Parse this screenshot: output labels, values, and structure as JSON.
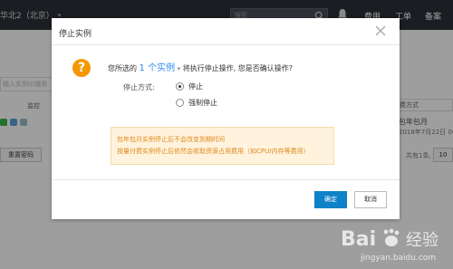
{
  "topbar": {
    "region": "华北2（北京）",
    "search_placeholder": "搜索",
    "links": [
      "费用",
      "工单",
      "备案"
    ]
  },
  "background": {
    "search_placeholder": "输入实例ID搜索",
    "column_monitor": "监控",
    "reset_button": "重置密码",
    "pay_mode_header": "付费方式",
    "pay_mode_value": "包年包月",
    "expire_text": "2018年7月22日 00:00",
    "total_text": "共有1条, 每页",
    "page_button": "10"
  },
  "dialog": {
    "title": "停止实例",
    "question_prefix": "您所选的",
    "question_count": "1 个实例",
    "question_suffix": "将执行停止操作, 您是否确认操作?",
    "stop_mode_label": "停止方式:",
    "options": [
      {
        "label": "停止",
        "checked": true
      },
      {
        "label": "强制停止",
        "checked": false
      }
    ],
    "notice_lines": [
      "包年包月实例停止后不会改变到期时间",
      "按量付费实例停止后依然会收取资源占用费用（如CPU/内存等费用）"
    ],
    "confirm_label": "确定",
    "cancel_label": "取消"
  },
  "colors": {
    "warning": "#f39800",
    "primary": "#0e82c8",
    "link": "#2d8cf0",
    "notice_bg": "#fff3dd",
    "notice_text": "#e08a1e"
  },
  "watermark": {
    "brand": "Baidu经验",
    "url": "jingyan.baidu.com"
  }
}
